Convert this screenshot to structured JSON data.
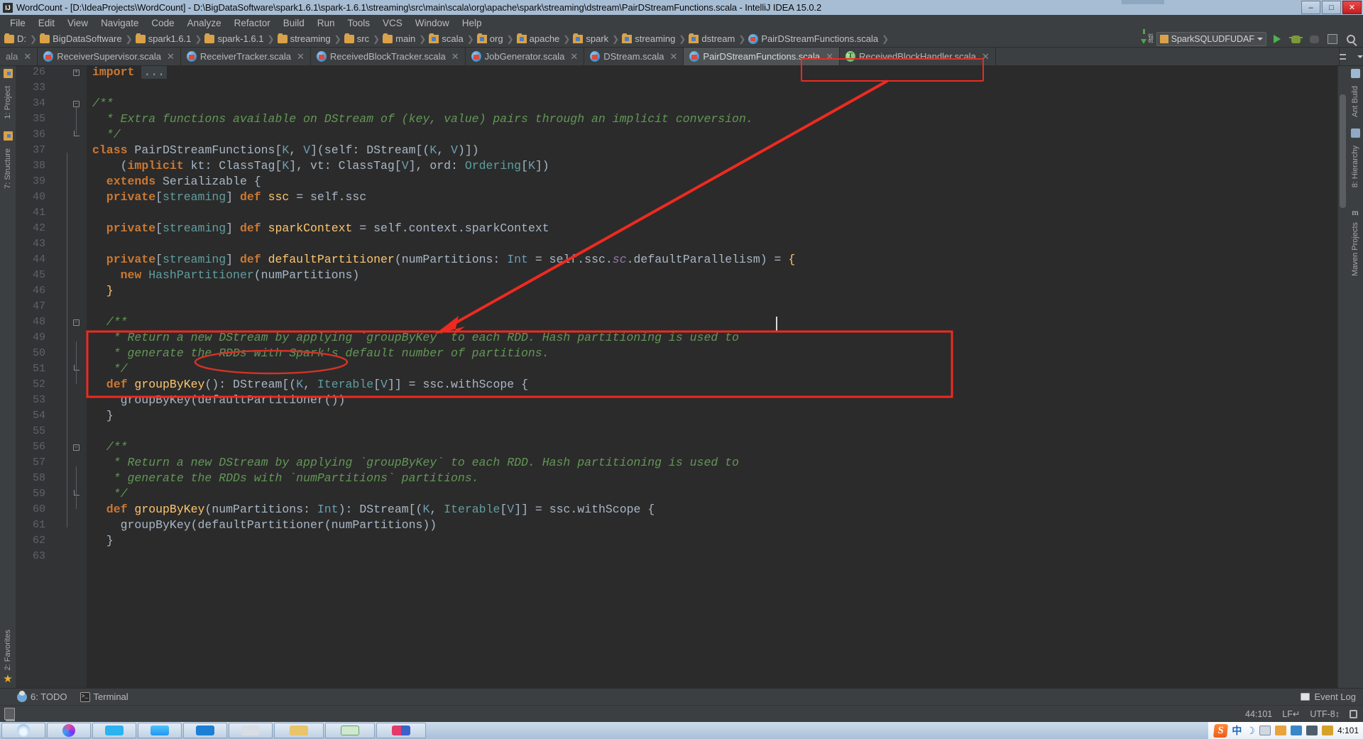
{
  "window": {
    "title": "WordCount - [D:\\IdeaProjects\\WordCount] - D:\\BigDataSoftware\\spark1.6.1\\spark-1.6.1\\streaming\\src\\main\\scala\\org\\apache\\spark\\streaming\\dstream\\PairDStreamFunctions.scala - IntelliJ IDEA 15.0.2",
    "icon": "intellij-idea-icon",
    "minimize": "–",
    "maximize": "□",
    "close": "✕"
  },
  "menu": {
    "items": [
      {
        "label": "File"
      },
      {
        "label": "Edit"
      },
      {
        "label": "View"
      },
      {
        "label": "Navigate"
      },
      {
        "label": "Code"
      },
      {
        "label": "Analyze"
      },
      {
        "label": "Refactor"
      },
      {
        "label": "Build"
      },
      {
        "label": "Run"
      },
      {
        "label": "Tools"
      },
      {
        "label": "VCS"
      },
      {
        "label": "Window"
      },
      {
        "label": "Help"
      }
    ]
  },
  "navbar": {
    "crumbs": [
      {
        "label": "D:",
        "icon": "folder-icon"
      },
      {
        "label": "BigDataSoftware",
        "icon": "folder-icon"
      },
      {
        "label": "spark1.6.1",
        "icon": "folder-icon"
      },
      {
        "label": "spark-1.6.1",
        "icon": "folder-icon"
      },
      {
        "label": "streaming",
        "icon": "folder-icon"
      },
      {
        "label": "src",
        "icon": "folder-icon"
      },
      {
        "label": "main",
        "icon": "folder-icon"
      },
      {
        "label": "scala",
        "icon": "source-folder-icon"
      },
      {
        "label": "org",
        "icon": "source-folder-icon"
      },
      {
        "label": "apache",
        "icon": "source-folder-icon"
      },
      {
        "label": "spark",
        "icon": "source-folder-icon"
      },
      {
        "label": "streaming",
        "icon": "source-folder-icon"
      },
      {
        "label": "dstream",
        "icon": "source-folder-icon"
      },
      {
        "label": "PairDStreamFunctions.scala",
        "icon": "scala-file-icon"
      }
    ],
    "run_config": "SparkSQLUDFUDAF",
    "buttons": [
      "run-button",
      "debug-button",
      "debug-disabled-button",
      "coverage-button",
      "search-everywhere-button"
    ]
  },
  "tabs": {
    "overflow_left_label": "ala",
    "items": [
      {
        "label": "ReceiverSupervisor.scala",
        "icon": "scala-file-icon",
        "active": false
      },
      {
        "label": "ReceiverTracker.scala",
        "icon": "scala-file-icon",
        "active": false
      },
      {
        "label": "ReceivedBlockTracker.scala",
        "icon": "scala-file-icon",
        "active": false
      },
      {
        "label": "JobGenerator.scala",
        "icon": "scala-file-icon",
        "active": false
      },
      {
        "label": "DStream.scala",
        "icon": "scala-file-icon",
        "active": false
      },
      {
        "label": "PairDStreamFunctions.scala",
        "icon": "scala-file-icon",
        "active": true
      },
      {
        "label": "ReceivedBlockHandler.scala",
        "icon": "scala-trait-icon",
        "active": false
      }
    ],
    "close_glyph": "✕"
  },
  "rails": {
    "left": [
      {
        "label": "1: Project",
        "icon": "project-icon"
      },
      {
        "label": "7: Structure",
        "icon": "structure-icon"
      },
      {
        "label": "2: Favorites",
        "icon": "favorites-star-icon"
      }
    ],
    "right": [
      {
        "label": "Ant Build",
        "icon": "ant-icon"
      },
      {
        "label": "8: Hierarchy",
        "icon": "hierarchy-icon"
      },
      {
        "label": "Maven Projects",
        "icon": "maven-icon"
      }
    ]
  },
  "editor": {
    "first_visible_line": 26,
    "lines": [
      {
        "n": 26,
        "fold": "plus",
        "partial": true,
        "tokens": [
          {
            "t": "import ",
            "c": "kw"
          },
          {
            "t": "...",
            "c": "folded"
          }
        ]
      },
      {
        "n": 33,
        "tokens": []
      },
      {
        "n": 34,
        "fold": "minus-top",
        "tokens": [
          {
            "t": "/**",
            "c": "cmt"
          }
        ]
      },
      {
        "n": 35,
        "tokens": [
          {
            "t": "  * Extra functions available on DStream of (key, value) pairs through an implicit conversion.",
            "c": "cmt"
          }
        ]
      },
      {
        "n": 36,
        "fold": "end",
        "tokens": [
          {
            "t": "  */",
            "c": "cmt"
          }
        ]
      },
      {
        "n": 37,
        "tokens": [
          {
            "t": "class ",
            "c": "kw"
          },
          {
            "t": "PairDStreamFunctions[",
            "c": "ident"
          },
          {
            "t": "K",
            "c": "gen"
          },
          {
            "t": ", ",
            "c": "ident"
          },
          {
            "t": "V",
            "c": "gen"
          },
          {
            "t": "](self: DStream[(",
            "c": "ident"
          },
          {
            "t": "K",
            "c": "gen"
          },
          {
            "t": ", ",
            "c": "ident"
          },
          {
            "t": "V",
            "c": "gen"
          },
          {
            "t": ")])",
            "c": "ident"
          }
        ]
      },
      {
        "n": 38,
        "tokens": [
          {
            "t": "    (",
            "c": "ident"
          },
          {
            "t": "implicit ",
            "c": "kw"
          },
          {
            "t": "kt: ClassTag[",
            "c": "ident"
          },
          {
            "t": "K",
            "c": "gen"
          },
          {
            "t": "], vt: ClassTag[",
            "c": "ident"
          },
          {
            "t": "V",
            "c": "gen"
          },
          {
            "t": "], ord: ",
            "c": "ident"
          },
          {
            "t": "Ordering",
            "c": "gen2"
          },
          {
            "t": "[",
            "c": "ident"
          },
          {
            "t": "K",
            "c": "gen"
          },
          {
            "t": "])",
            "c": "ident"
          }
        ]
      },
      {
        "n": 39,
        "tokens": [
          {
            "t": "  extends ",
            "c": "kw"
          },
          {
            "t": "Serializable {",
            "c": "ident"
          }
        ]
      },
      {
        "n": 40,
        "tokens": [
          {
            "t": "  private",
            "c": "kw"
          },
          {
            "t": "[",
            "c": "ident"
          },
          {
            "t": "streaming",
            "c": "gen2"
          },
          {
            "t": "] ",
            "c": "ident"
          },
          {
            "t": "def ",
            "c": "kw"
          },
          {
            "t": "ssc",
            "c": "fn"
          },
          {
            "t": " = self.ssc",
            "c": "ident"
          }
        ]
      },
      {
        "n": 41,
        "tokens": []
      },
      {
        "n": 42,
        "tokens": [
          {
            "t": "  private",
            "c": "kw"
          },
          {
            "t": "[",
            "c": "ident"
          },
          {
            "t": "streaming",
            "c": "gen2"
          },
          {
            "t": "] ",
            "c": "ident"
          },
          {
            "t": "def ",
            "c": "kw"
          },
          {
            "t": "sparkContext",
            "c": "fn"
          },
          {
            "t": " = self.context.sparkContext",
            "c": "ident"
          }
        ]
      },
      {
        "n": 43,
        "tokens": []
      },
      {
        "n": 44,
        "tokens": [
          {
            "t": "  private",
            "c": "kw"
          },
          {
            "t": "[",
            "c": "ident"
          },
          {
            "t": "streaming",
            "c": "gen2"
          },
          {
            "t": "] ",
            "c": "ident"
          },
          {
            "t": "def ",
            "c": "kw"
          },
          {
            "t": "defaultPartitioner",
            "c": "fn"
          },
          {
            "t": "(numPartitions: ",
            "c": "ident"
          },
          {
            "t": "Int",
            "c": "gen"
          },
          {
            "t": " = self.ssc.",
            "c": "ident"
          },
          {
            "t": "sc",
            "c": "fld"
          },
          {
            "t": ".defaultParallelism) = ",
            "c": "ident"
          },
          {
            "t": "{",
            "c": "brace"
          }
        ]
      },
      {
        "n": 45,
        "tokens": [
          {
            "t": "    new ",
            "c": "kw"
          },
          {
            "t": "HashPartitioner",
            "c": "gen2"
          },
          {
            "t": "(numPartitions)",
            "c": "ident"
          }
        ]
      },
      {
        "n": 46,
        "tokens": [
          {
            "t": "  }",
            "c": "brace"
          }
        ]
      },
      {
        "n": 47,
        "tokens": []
      },
      {
        "n": 48,
        "fold": "minus-top",
        "tokens": [
          {
            "t": "  /**",
            "c": "cmt"
          }
        ]
      },
      {
        "n": 49,
        "tokens": [
          {
            "t": "   * Return a new DStream by applying `groupByKey` to each RDD. Hash partitioning is used to",
            "c": "cmt"
          }
        ]
      },
      {
        "n": 50,
        "tokens": [
          {
            "t": "   * generate the RDDs with Spark's default number of partitions.",
            "c": "cmt"
          }
        ]
      },
      {
        "n": 51,
        "fold": "end",
        "tokens": [
          {
            "t": "   */",
            "c": "cmt"
          }
        ]
      },
      {
        "n": 52,
        "tokens": [
          {
            "t": "  def ",
            "c": "kw"
          },
          {
            "t": "groupByKey",
            "c": "fn"
          },
          {
            "t": "(): DStream[(",
            "c": "ident"
          },
          {
            "t": "K",
            "c": "gen"
          },
          {
            "t": ", ",
            "c": "ident"
          },
          {
            "t": "Iterable",
            "c": "gen2"
          },
          {
            "t": "[",
            "c": "ident"
          },
          {
            "t": "V",
            "c": "gen"
          },
          {
            "t": "]] = ssc.withScope {",
            "c": "ident"
          }
        ]
      },
      {
        "n": 53,
        "tokens": [
          {
            "t": "    groupByKey(defaultPartitioner())",
            "c": "ident"
          }
        ]
      },
      {
        "n": 54,
        "tokens": [
          {
            "t": "  }",
            "c": "ident"
          }
        ]
      },
      {
        "n": 55,
        "tokens": []
      },
      {
        "n": 56,
        "fold": "minus-top",
        "tokens": [
          {
            "t": "  /**",
            "c": "cmt"
          }
        ]
      },
      {
        "n": 57,
        "tokens": [
          {
            "t": "   * Return a new DStream by applying `groupByKey` to each RDD. Hash partitioning is used to",
            "c": "cmt"
          }
        ]
      },
      {
        "n": 58,
        "tokens": [
          {
            "t": "   * generate the RDDs with `numPartitions` partitions.",
            "c": "cmt"
          }
        ]
      },
      {
        "n": 59,
        "fold": "end",
        "tokens": [
          {
            "t": "   */",
            "c": "cmt"
          }
        ]
      },
      {
        "n": 60,
        "tokens": [
          {
            "t": "  def ",
            "c": "kw"
          },
          {
            "t": "groupByKey",
            "c": "fn"
          },
          {
            "t": "(numPartitions: ",
            "c": "ident"
          },
          {
            "t": "Int",
            "c": "gen"
          },
          {
            "t": "): DStream[(",
            "c": "ident"
          },
          {
            "t": "K",
            "c": "gen"
          },
          {
            "t": ", ",
            "c": "ident"
          },
          {
            "t": "Iterable",
            "c": "gen2"
          },
          {
            "t": "[",
            "c": "ident"
          },
          {
            "t": "V",
            "c": "gen"
          },
          {
            "t": "]] = ssc.withScope {",
            "c": "ident"
          }
        ]
      },
      {
        "n": 61,
        "tokens": [
          {
            "t": "    groupByKey(defaultPartitioner(numPartitions))",
            "c": "ident"
          }
        ]
      },
      {
        "n": 62,
        "tokens": [
          {
            "t": "  }",
            "c": "ident"
          }
        ]
      },
      {
        "n": 63,
        "tokens": []
      }
    ]
  },
  "annotations": {
    "tab_highlight": "red-rectangle-around-active-tab",
    "code_highlight": "red-rectangle-around-defaultPartitioner",
    "arrow": "red-arrow-from-tab-to-code",
    "ellipse": "red-ellipse-around-HashPartitioner",
    "color": "#ee2a20"
  },
  "bottom_tools": {
    "items": [
      {
        "label": "6: TODO",
        "icon": "todo-icon"
      },
      {
        "label": "Terminal",
        "icon": "terminal-icon"
      }
    ],
    "event_log": {
      "label": "Event Log",
      "icon": "event-log-icon"
    }
  },
  "statusbar": {
    "left_icon": "show-tool-windows-icon",
    "position": "44:101",
    "line_separator": "LF↵",
    "encoding": "UTF-8↕",
    "lock": "lock-icon"
  },
  "taskbar": {
    "apps": [
      "browser-app",
      "chrome-app",
      "skype-app",
      "edge-app",
      "explorer-app",
      "note-app",
      "folder-app",
      "notepad-app",
      "office-app"
    ],
    "tray": {
      "ime_logo": "S",
      "ime_mode": "中",
      "ime_moon": "☽",
      "icons": [
        "keyboard-icon",
        "mail-icon",
        "backpack-icon",
        "trash-icon",
        "wrench-icon"
      ],
      "time": "4:101"
    }
  }
}
